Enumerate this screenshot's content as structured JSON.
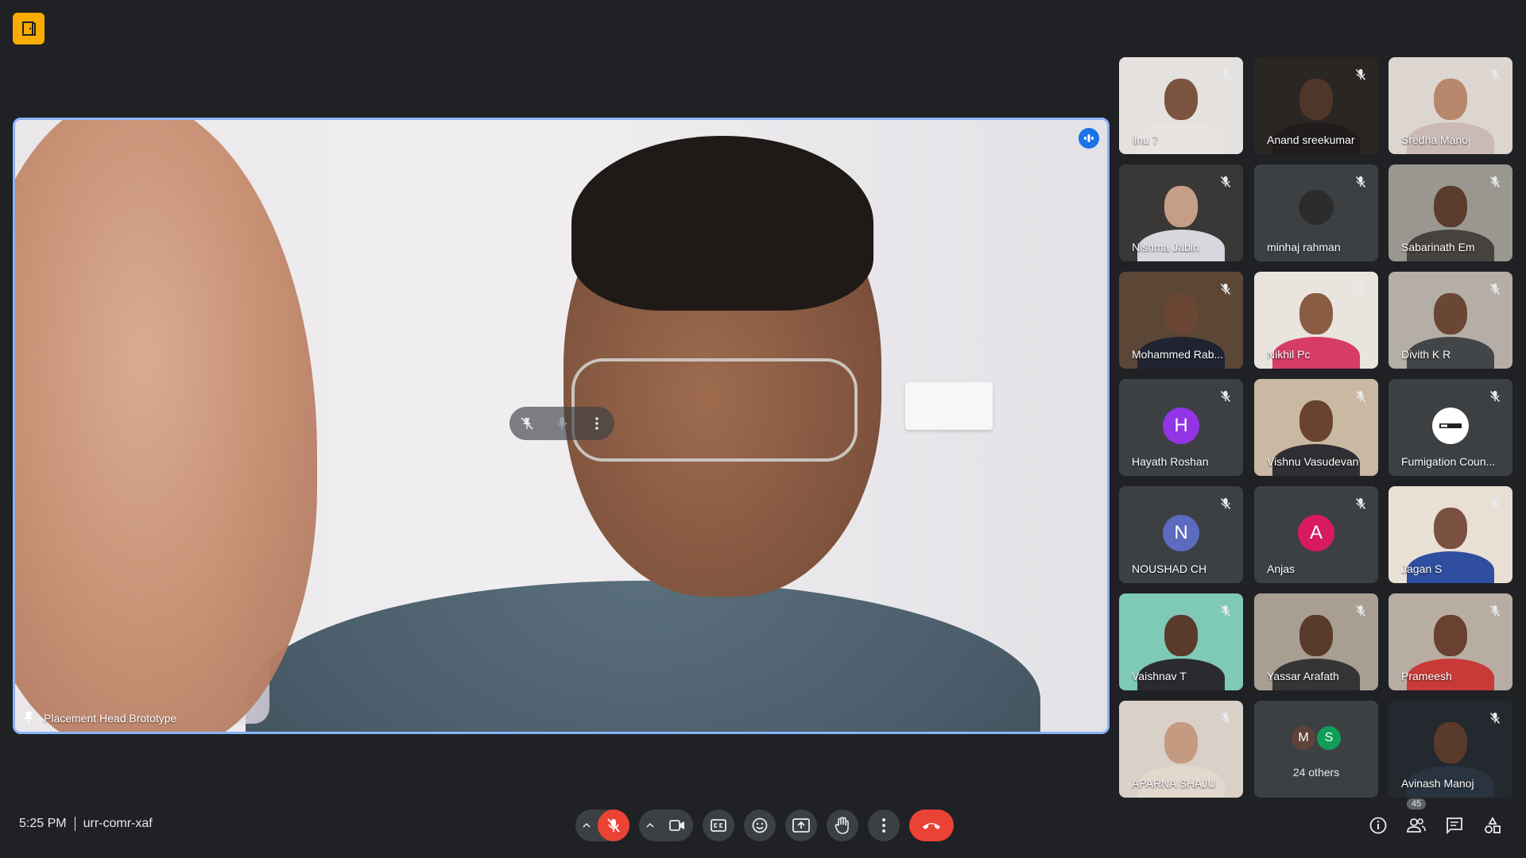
{
  "main_speaker": {
    "name": "Placement Head Brototype"
  },
  "participants": [
    {
      "name": "jinu 7",
      "type": "video",
      "bg": "#e5e1df",
      "skin": "#7c5440",
      "shirt": "#e8e4e2"
    },
    {
      "name": "Anand sreekumar",
      "type": "video",
      "bg": "#2a2624",
      "skin": "#4e3628",
      "shirt": "#1f1c1b"
    },
    {
      "name": "Sredha Manoj",
      "type": "video",
      "bg": "#ddd5cf",
      "skin": "#b8866b",
      "shirt": "#cbb9b3"
    },
    {
      "name": "Nishma Jabin",
      "type": "video",
      "bg": "#3a3837",
      "skin": "#c49e86",
      "shirt": "#d9d6dd"
    },
    {
      "name": "minhaj rahman",
      "type": "video-small",
      "bg": "#3c4043",
      "skin": "#2c2c2c",
      "shirt": "#3c4043"
    },
    {
      "name": "Sabarinath Em",
      "type": "video",
      "bg": "#9a9690",
      "skin": "#5a3c2c",
      "shirt": "#45423f"
    },
    {
      "name": "Mohammed Rab...",
      "type": "video",
      "bg": "#5c4636",
      "skin": "#6b4634",
      "shirt": "#1f2430"
    },
    {
      "name": "Nikhil Pc",
      "type": "video",
      "bg": "#e9e4de",
      "skin": "#8a5c44",
      "shirt": "#d63c66"
    },
    {
      "name": "Divith K R",
      "type": "video",
      "bg": "#b4aea6",
      "skin": "#6a4634",
      "shirt": "#434648"
    },
    {
      "name": "Hayath Roshan",
      "type": "avatar",
      "letter": "H",
      "color": "#9334e6"
    },
    {
      "name": "Vishnu Vasudevan",
      "type": "video",
      "bg": "#c9b8a2",
      "skin": "#6a4230",
      "shirt": "#2f2f33"
    },
    {
      "name": "Fumigation Coun...",
      "type": "logo",
      "color": "#ffffff"
    },
    {
      "name": "NOUSHAD CH",
      "type": "avatar",
      "letter": "N",
      "color": "#5c6bc0"
    },
    {
      "name": "Anjas",
      "type": "avatar",
      "letter": "A",
      "color": "#d81b60"
    },
    {
      "name": "Jagan S",
      "type": "video",
      "bg": "#e8dfd5",
      "skin": "#7a5040",
      "shirt": "#2f4ea0"
    },
    {
      "name": "Vaishnav T",
      "type": "video",
      "bg": "#7fc9b7",
      "skin": "#5a3a2a",
      "shirt": "#2a2a30"
    },
    {
      "name": "Yassar Arafath",
      "type": "video",
      "bg": "#a89e92",
      "skin": "#5a3a2a",
      "shirt": "#353437"
    },
    {
      "name": "Prameesh",
      "type": "video",
      "bg": "#b7ada3",
      "skin": "#6a4030",
      "shirt": "#c83a38"
    },
    {
      "name": "APARNA SHAJU",
      "type": "video",
      "bg": "#d9d0c8",
      "skin": "#c49a80",
      "shirt": "#e3d8ce"
    },
    {
      "name": "24 others",
      "type": "others",
      "avatars": [
        {
          "letter": "M",
          "color": "#5f4339"
        },
        {
          "letter": "S",
          "color": "#0f9d58"
        }
      ]
    },
    {
      "name": "Avinash Manoj",
      "type": "video",
      "bg": "#23292e",
      "skin": "#5a3a2a",
      "shirt": "#2a3340"
    }
  ],
  "meeting": {
    "time": "5:25 PM",
    "code": "urr-comr-xaf"
  },
  "people_count": "45",
  "colors": {
    "accent": "#8ab4f8",
    "danger": "#ea4335",
    "surface": "#3c4043",
    "bg": "#202124"
  }
}
